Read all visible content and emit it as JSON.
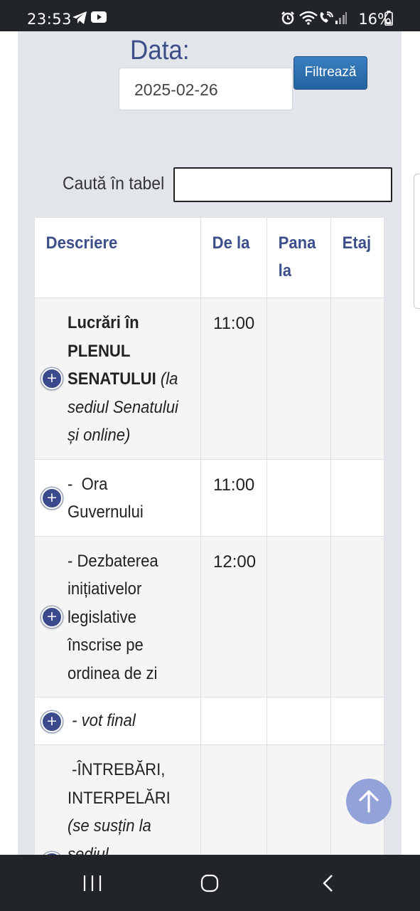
{
  "status_bar": {
    "time": "23:53",
    "battery": "16%",
    "icons": [
      "telegram-icon",
      "youtube-icon",
      "alarm-icon",
      "wifi-icon",
      "wifi-call-icon",
      "signal-icon",
      "battery-icon"
    ]
  },
  "filter": {
    "date_label": "Data:",
    "date_value": "2025-02-26",
    "button_label": "Filtrează"
  },
  "search": {
    "label": "Caută în tabel",
    "value": ""
  },
  "table": {
    "headers": {
      "desc": "Descriere",
      "from": "De la",
      "to": "Pana la",
      "floor": "Etaj"
    },
    "rows": [
      {
        "desc_bold": "Lucrări în PLENUL SENATULUI",
        "desc_italic": " (la sediul Senatului și online)",
        "from": "11:00",
        "to": "",
        "floor": ""
      },
      {
        "desc_text": "-  Ora Guvernului",
        "from": "11:00",
        "to": "",
        "floor": ""
      },
      {
        "desc_text": "- Dezbaterea inițiativelor legislative înscrise pe ordinea de zi",
        "from": "12:00",
        "to": "",
        "floor": ""
      },
      {
        "desc_italic": " - vot final",
        "from": "",
        "to": "",
        "floor": ""
      },
      {
        "desc_text": " -ÎNTREBĂRI, INTERPELĂRI",
        "desc_italic": "(se susțin la sediul",
        "from": "",
        "to": "",
        "floor": ""
      }
    ]
  },
  "colors": {
    "accent": "#3d4f8a",
    "button": "#2a6aad",
    "panel": "#e2e6ea",
    "scroll_top": "#8e9fd8"
  }
}
